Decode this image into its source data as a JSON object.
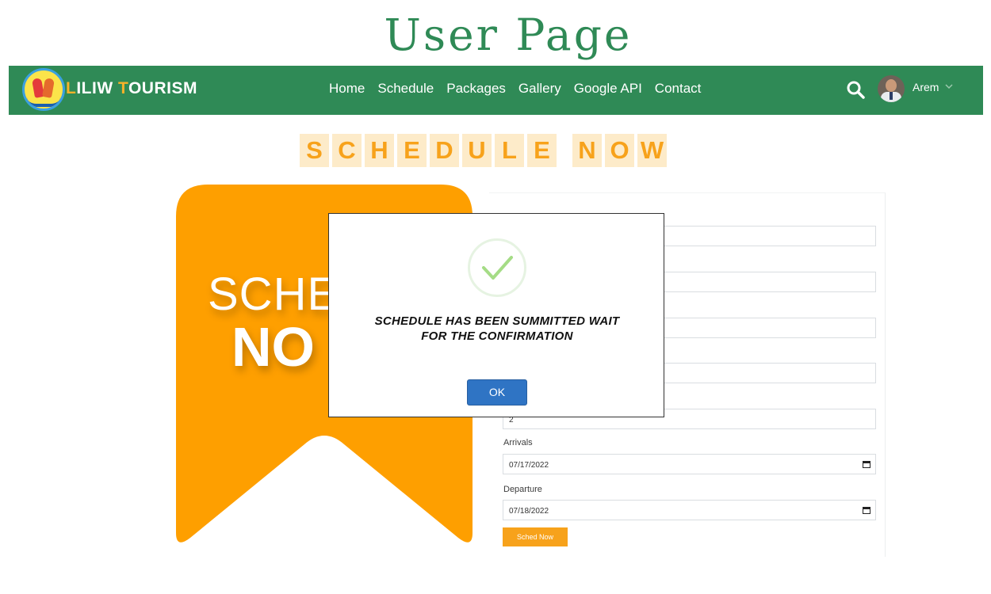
{
  "page": {
    "title": "User Page"
  },
  "navbar": {
    "brand_first": "L",
    "brand_mid": "ILIW ",
    "brand_accent": "T",
    "brand_last": "OURISM",
    "links": [
      "Home",
      "Schedule",
      "Packages",
      "Gallery",
      "Google API",
      "Contact"
    ],
    "user_name": "Arem",
    "icons": {
      "search": "search-icon",
      "dropdown": "chevron-down-icon"
    }
  },
  "schedule_heading": {
    "word1": [
      "S",
      "C",
      "H",
      "E",
      "D",
      "U",
      "L",
      "E"
    ],
    "word2": [
      "N",
      "O",
      "W"
    ]
  },
  "banner": {
    "line1": "SCHE",
    "line2": "NO"
  },
  "form": {
    "guests_value": "2",
    "arrivals_label": "Arrivals",
    "arrivals_value": "07/17/2022",
    "departure_label": "Departure",
    "departure_value": "07/18/2022",
    "submit_label": "Sched Now"
  },
  "modal": {
    "line1": "SCHEDULE HAS BEEN SUMMITTED WAIT",
    "line2": "FOR THE CONFIRMATION",
    "ok_label": "OK",
    "icon": "check-icon"
  },
  "colors": {
    "brand_green": "#2f8a56",
    "accent_orange": "#f7a21b",
    "ok_blue": "#2f74c4"
  }
}
